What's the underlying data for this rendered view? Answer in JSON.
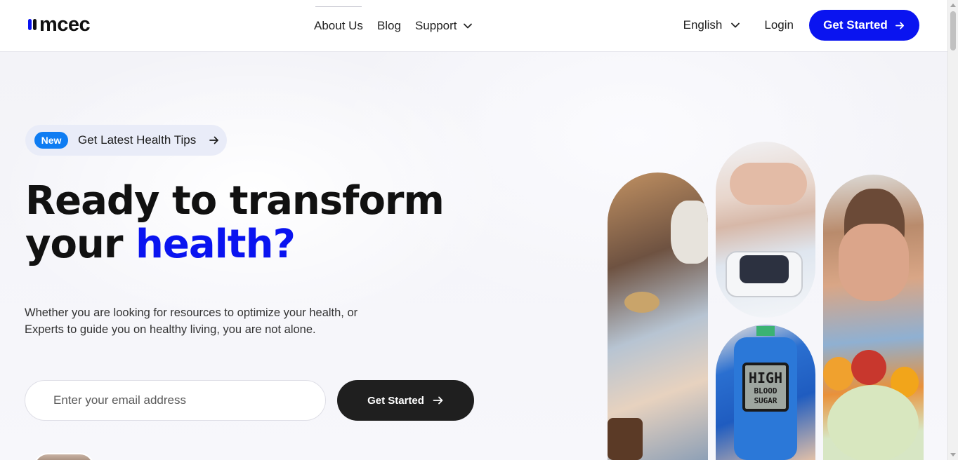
{
  "brand": {
    "name": "mcec",
    "accent": "#0a14f0",
    "dark": "#1f1f1f"
  },
  "nav": {
    "items": [
      {
        "label": "About Us"
      },
      {
        "label": "Blog"
      },
      {
        "label": "Support"
      }
    ],
    "language": "English",
    "login": "Login",
    "cta": "Get Started"
  },
  "hero": {
    "pill": {
      "badge": "New",
      "text": "Get Latest Health Tips"
    },
    "headline_line1": "Ready to transform",
    "headline_line2_prefix": "your ",
    "headline_line2_accent": "health?",
    "subtext_line1": "Whether you are looking for resources to optimize your health, or",
    "subtext_line2": "Experts to guide you on healthy living, you are not alone.",
    "email_placeholder": "Enter your email address",
    "cta": "Get Started"
  },
  "images": {
    "meter_line1": "HIGH",
    "meter_line2": "BLOOD",
    "meter_line3": "SUGAR"
  }
}
